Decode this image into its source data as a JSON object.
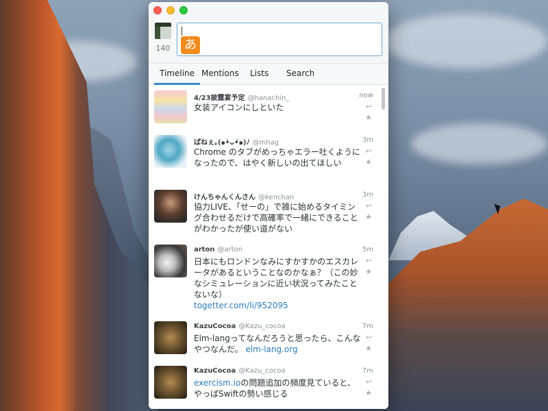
{
  "compose": {
    "char_count": "140",
    "ime_indicator": "あ"
  },
  "tabs": [
    {
      "label": "Timeline",
      "active": true
    },
    {
      "label": "Mentions",
      "active": false
    },
    {
      "label": "Lists",
      "active": false
    },
    {
      "label": "Search",
      "active": false
    }
  ],
  "tweets": [
    {
      "name": "4/23披露宴予定",
      "handle": "@hanachin_",
      "time": "now",
      "text": "女装アイコンにしといた",
      "link": ""
    },
    {
      "name": "ぱねぇ｡(๑•̀ᴗ•́๑)ﾉ",
      "handle": "@mhag",
      "time": "3m",
      "text": "Chrome のタブがめっちゃエラー吐くようになったので、はやく新しいの出てほしい",
      "link": ""
    },
    {
      "name": "けんちゃんくんさん",
      "handle": "@kenchan",
      "time": "3m",
      "text": "協力LIVE、「せーの」で雑に始めるタイミング合わせるだけで高確率で一緒にできることがわかったが使い道がない",
      "link": ""
    },
    {
      "name": "arton",
      "handle": "@arton",
      "time": "5m",
      "text": "日本にもロンドンなみにすかすかのエスカレータがあるということなのかなぁ？（この妙なシミュレーションに近い状況ってみたことないな）",
      "link": "togetter.com/li/952095"
    },
    {
      "name": "KazuCocoa",
      "handle": "@Kazu_cocoa",
      "time": "7m",
      "text": "Elm-langってなんだろうと思ったら、こんなやつなんだ。",
      "link": "elm-lang.org"
    },
    {
      "name": "KazuCocoa",
      "handle": "@Kazu_cocoa",
      "time": "7m",
      "text_link": "exercism.io",
      "text": "の問題追加の頻度見ていると、やっぱSwiftの勢い感じる",
      "link": ""
    }
  ],
  "icons": {
    "reply": "reply-icon",
    "favorite": "star-icon"
  }
}
